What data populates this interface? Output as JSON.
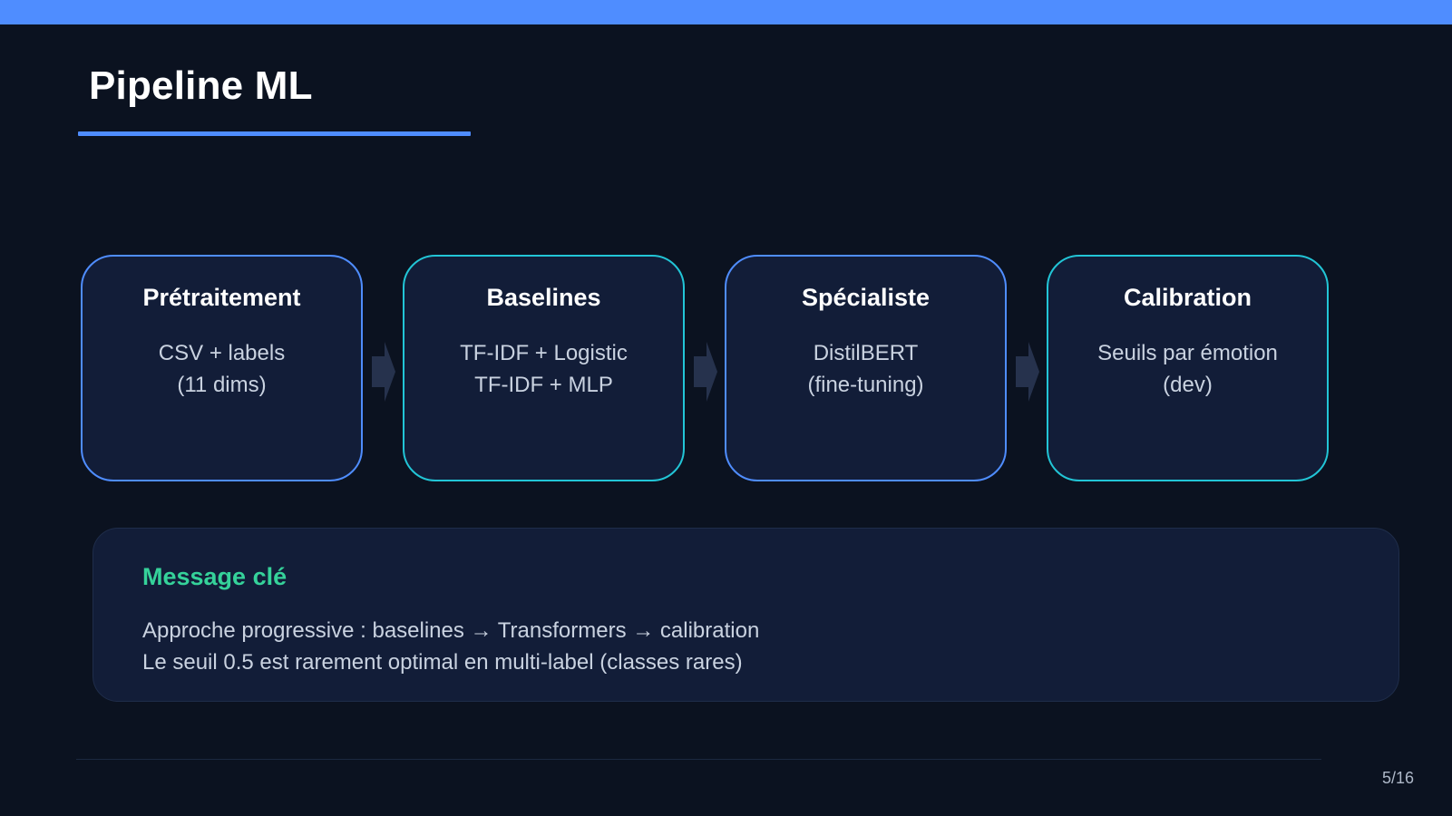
{
  "colors": {
    "background": "#0b1220",
    "accent": "#4f8dff",
    "accent_alt": "#22c5d6",
    "card_fill": "#121d38",
    "key_title": "#35d29a"
  },
  "slide": {
    "title": "Pipeline ML",
    "page": "5/16"
  },
  "pipeline": {
    "stages": [
      {
        "title": "Prétraitement",
        "lines": [
          "CSV + labels",
          "(11 dims)"
        ]
      },
      {
        "title": "Baselines",
        "lines": [
          "TF-IDF + Logistic",
          "TF-IDF + MLP"
        ]
      },
      {
        "title": "Spécialiste",
        "lines": [
          "DistilBERT",
          "(fine-tuning)"
        ]
      },
      {
        "title": "Calibration",
        "lines": [
          "Seuils par émotion",
          "(dev)"
        ]
      }
    ],
    "connector_icon": "arrow-right-icon"
  },
  "key_message": {
    "title": "Message clé",
    "lines": [
      "Approche progressive : baselines → Transformers → calibration",
      "Le seuil 0.5 est rarement optimal en multi-label (classes rares)"
    ]
  }
}
